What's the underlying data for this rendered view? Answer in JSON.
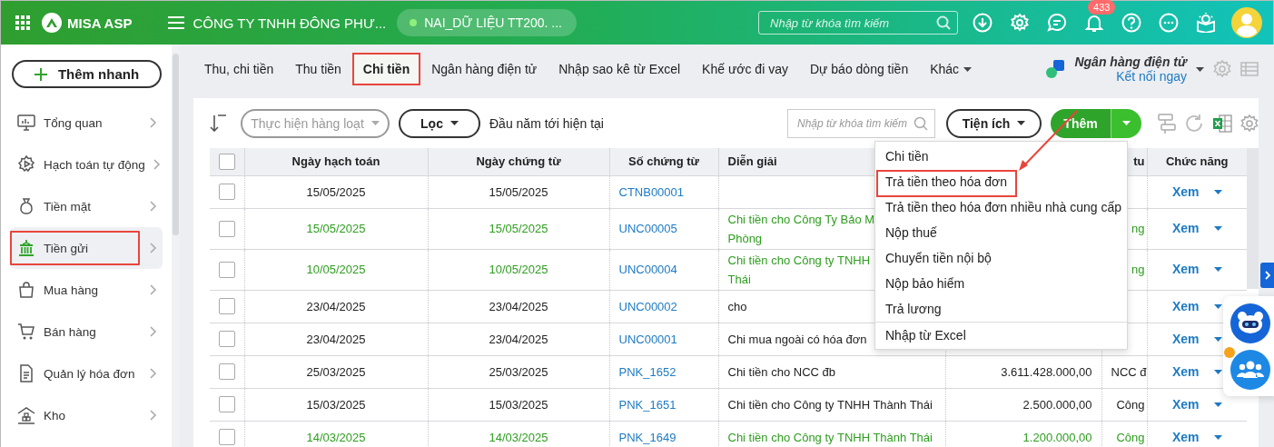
{
  "topbar": {
    "app_name": "MISA ASP",
    "company": "CÔNG TY TNHH ĐÔNG PHƯ...",
    "database": "NAI_DỮ LIỆU TT200. ...",
    "search": {
      "placeholder": "Nhập từ khóa tìm kiếm"
    },
    "notification_count": "433"
  },
  "sidebar": {
    "quick_add": "Thêm nhanh",
    "items": [
      {
        "label": "Tổng quan",
        "selected": false,
        "highlighted": false
      },
      {
        "label": "Hạch toán tự động",
        "selected": false,
        "highlighted": false
      },
      {
        "label": "Tiền mặt",
        "selected": false,
        "highlighted": false
      },
      {
        "label": "Tiền gửi",
        "selected": true,
        "highlighted": true
      },
      {
        "label": "Mua hàng",
        "selected": false,
        "highlighted": false
      },
      {
        "label": "Bán hàng",
        "selected": false,
        "highlighted": false
      },
      {
        "label": "Quản lý hóa đơn",
        "selected": false,
        "highlighted": false
      },
      {
        "label": "Kho",
        "selected": false,
        "highlighted": false
      }
    ]
  },
  "tabs": [
    {
      "label": "Thu, chi tiền",
      "selected": false,
      "highlighted": false
    },
    {
      "label": "Thu tiền",
      "selected": false,
      "highlighted": false
    },
    {
      "label": "Chi tiền",
      "selected": true,
      "highlighted": true
    },
    {
      "label": "Ngân hàng điện tử",
      "selected": false,
      "highlighted": false
    },
    {
      "label": "Nhập sao kê từ Excel",
      "selected": false,
      "highlighted": false
    },
    {
      "label": "Khế ước đi vay",
      "selected": false,
      "highlighted": false
    },
    {
      "label": "Dự báo dòng tiền",
      "selected": false,
      "highlighted": false
    },
    {
      "label": "Khác",
      "selected": false,
      "highlighted": false,
      "dropdown": true
    }
  ],
  "bank": {
    "title": "Ngân hàng điện tử",
    "link": "Kết nối ngay"
  },
  "toolbar": {
    "batch": {
      "label": "Thực hiện hàng loạt",
      "disabled": true
    },
    "filter": "Lọc",
    "period": "Đầu năm tới hiện tại",
    "search": {
      "placeholder": "Nhập từ khóa tìm kiếm"
    },
    "utilities": "Tiện ích",
    "add": "Thêm"
  },
  "table": {
    "header_checked": false,
    "columns": [
      "Ngày hạch toán",
      "Ngày chứng từ",
      "Số chứng từ",
      "Diễn giải",
      "",
      "tu",
      "Chức năng"
    ],
    "rows": [
      {
        "checked": false,
        "color": "#222222",
        "posting_date": "15/05/2025",
        "doc_date": "15/05/2025",
        "doc_no": "CTNB00001",
        "description": "",
        "amount": "",
        "party": "",
        "action": "Xem"
      },
      {
        "checked": false,
        "color": "#2e9e1f",
        "posting_date": "15/05/2025",
        "doc_date": "15/05/2025",
        "doc_no": "UNC00005",
        "description": "Chi tiền cho Công Ty Bảo M\nPhòng",
        "amount": "",
        "party": "ng",
        "action": "Xem"
      },
      {
        "checked": false,
        "color": "#2e9e1f",
        "posting_date": "10/05/2025",
        "doc_date": "10/05/2025",
        "doc_no": "UNC00004",
        "description": "Chi tiền cho Công ty TNHH\nThái",
        "amount": "",
        "party": "ng",
        "action": "Xem"
      },
      {
        "checked": false,
        "color": "#222222",
        "posting_date": "23/04/2025",
        "doc_date": "23/04/2025",
        "doc_no": "UNC00002",
        "description": "cho",
        "amount": "",
        "party": "",
        "action": "Xem"
      },
      {
        "checked": false,
        "color": "#222222",
        "posting_date": "23/04/2025",
        "doc_date": "23/04/2025",
        "doc_no": "UNC00001",
        "description": "Chi mua ngoài có hóa đơn",
        "amount": "",
        "party": "",
        "action": "Xem"
      },
      {
        "checked": false,
        "color": "#222222",
        "posting_date": "25/03/2025",
        "doc_date": "25/03/2025",
        "doc_no": "PNK_1652",
        "description": "Chi tiền cho NCC đb",
        "amount": "3.611.428.000,00",
        "party": "NCC đ",
        "action": "Xem"
      },
      {
        "checked": false,
        "color": "#222222",
        "posting_date": "15/03/2025",
        "doc_date": "15/03/2025",
        "doc_no": "PNK_1651",
        "description": "Chi tiền cho Công ty TNHH Thành Thái",
        "amount": "2.500.000,00",
        "party": "Công",
        "action": "Xem"
      },
      {
        "checked": false,
        "color": "#2e9e1f",
        "posting_date": "14/03/2025",
        "doc_date": "14/03/2025",
        "doc_no": "PNK_1649",
        "description": "Chi tiền cho Công ty TNHH Thành Thái",
        "amount": "1.200.000,00",
        "party": "Công",
        "action": "Xem"
      }
    ]
  },
  "add_menu": {
    "items": [
      {
        "label": "Chi tiền",
        "highlighted": false,
        "separator_before": false
      },
      {
        "label": "Trả tiền theo hóa đơn",
        "highlighted": true,
        "separator_before": false
      },
      {
        "label": "Trả tiền theo hóa đơn nhiều nhà cung cấp",
        "highlighted": false,
        "separator_before": false
      },
      {
        "label": "Nộp thuế",
        "highlighted": false,
        "separator_before": false
      },
      {
        "label": "Chuyển tiền nội bộ",
        "highlighted": false,
        "separator_before": false
      },
      {
        "label": "Nộp bảo hiểm",
        "highlighted": false,
        "separator_before": false
      },
      {
        "label": "Trả lương",
        "highlighted": false,
        "separator_before": false
      },
      {
        "label": "Nhập từ Excel",
        "highlighted": false,
        "separator_before": true
      }
    ]
  }
}
